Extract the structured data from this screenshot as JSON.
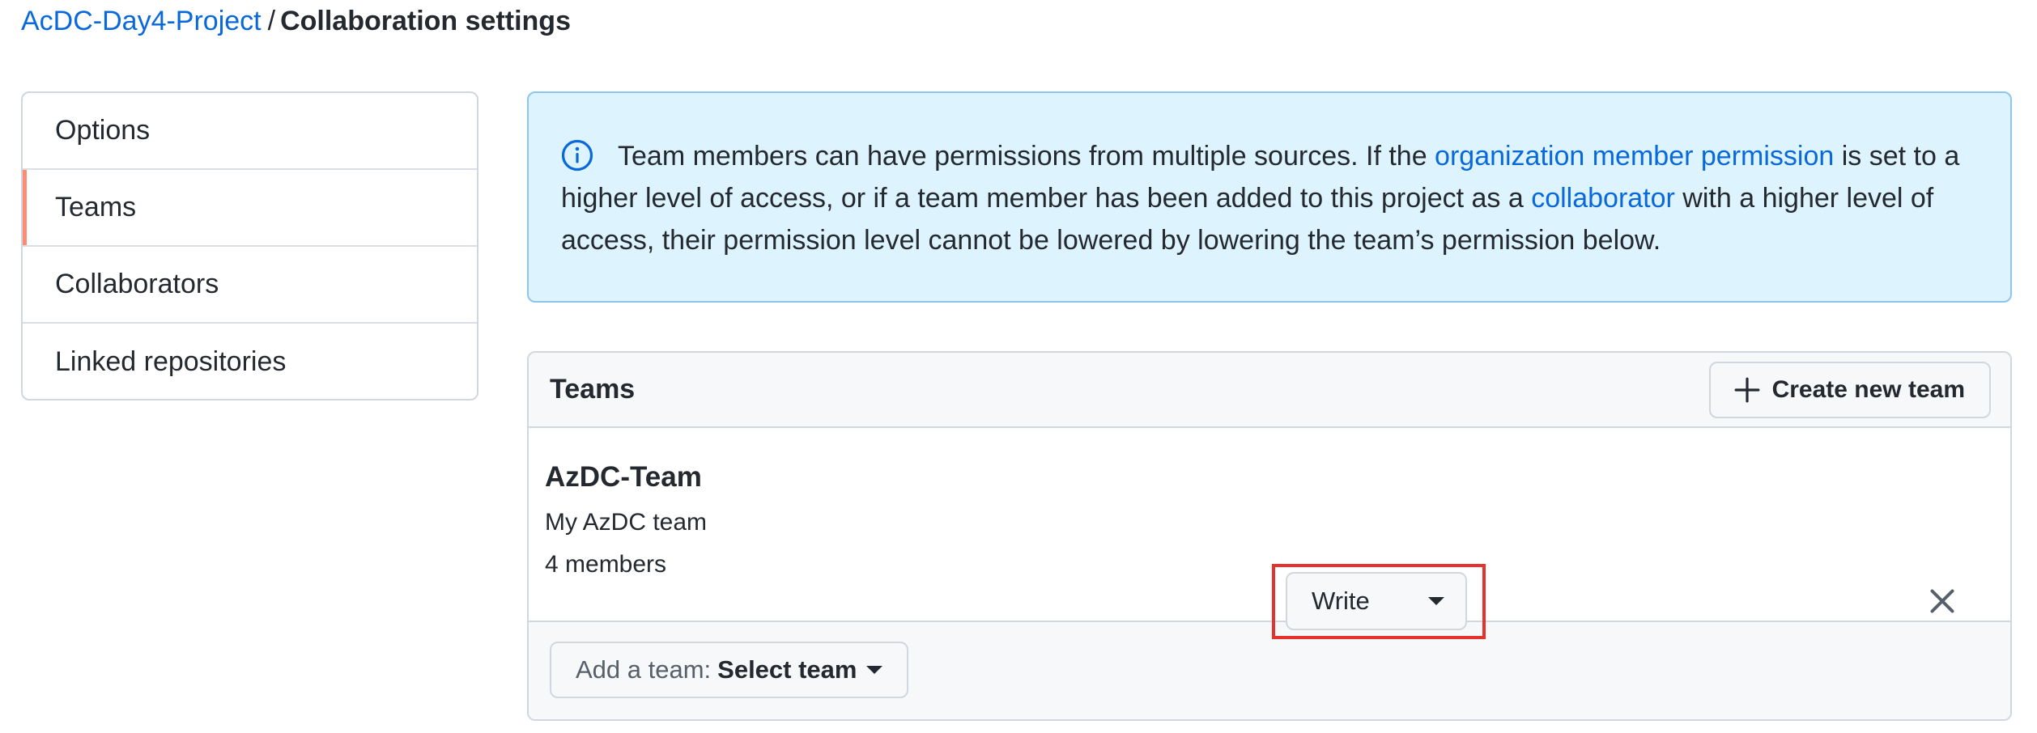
{
  "breadcrumb": {
    "project": "AcDC-Day4-Project",
    "separator": "/",
    "page": "Collaboration settings"
  },
  "sidebar": {
    "items": [
      {
        "label": "Options",
        "selected": false
      },
      {
        "label": "Teams",
        "selected": true
      },
      {
        "label": "Collaborators",
        "selected": false
      },
      {
        "label": "Linked repositories",
        "selected": false
      }
    ]
  },
  "flash": {
    "icon": "info-icon",
    "text_1": "Team members can have permissions from multiple sources. If the ",
    "link_1": "organization member permission",
    "text_2": " is set to a higher level of access, or if a team member has been added to this project as a ",
    "link_2": "collaborator",
    "text_3": " with a higher level of access, their permission level cannot be lowered by lowering the team’s permission below."
  },
  "teams_box": {
    "title": "Teams",
    "create_button": "Create new team",
    "teams": [
      {
        "name": "AzDC-Team",
        "description": "My AzDC team",
        "members": "4 members",
        "permission": "Write"
      }
    ],
    "add_team": {
      "label": "Add a team:",
      "value": "Select team"
    }
  },
  "colors": {
    "link": "#0969da",
    "selected_accent": "#fd8c73",
    "flash_bg": "#ddf4ff",
    "highlight": "#e5322d"
  }
}
